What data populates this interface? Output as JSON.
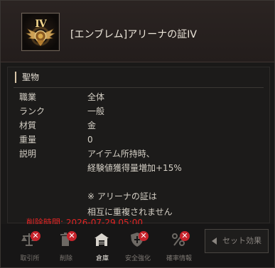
{
  "item": {
    "icon_numeral": "IV",
    "name": "[エンブレム]アリーナの証IV"
  },
  "section": {
    "title": "聖物"
  },
  "stats": [
    {
      "label": "職業",
      "value": "全体"
    },
    {
      "label": "ランク",
      "value": "一般"
    },
    {
      "label": "材質",
      "value": "金"
    },
    {
      "label": "重量",
      "value": "0"
    },
    {
      "label": "説明",
      "value": "アイテム所持時、"
    }
  ],
  "description_lines": [
    "経験値獲得量増加+15%",
    "※ アリーナの証は",
    "相互に重複されません"
  ],
  "expiry": {
    "text": "削除時間: 2026-07-29  05:00",
    "color": "#e12424"
  },
  "footer": {
    "buttons": [
      {
        "label": "取引所",
        "icon": "scale-icon",
        "disabled": true
      },
      {
        "label": "削除",
        "icon": "trash-icon",
        "disabled": true
      },
      {
        "label": "倉庫",
        "icon": "warehouse-icon",
        "disabled": false
      },
      {
        "label": "安全強化",
        "icon": "shield-icon",
        "disabled": true
      },
      {
        "label": "確率情報",
        "icon": "percent-icon",
        "disabled": true
      }
    ],
    "set_effect_label": "セット効果"
  }
}
